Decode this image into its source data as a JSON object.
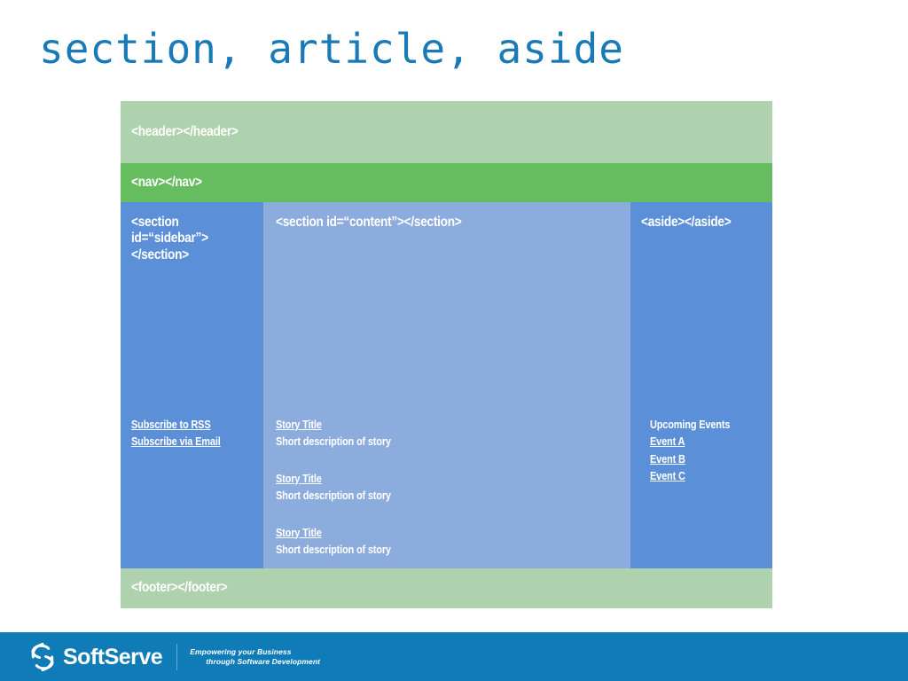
{
  "slide": {
    "title": "section, article, aside",
    "title_color": "#1a7ab8"
  },
  "diagram": {
    "header": {
      "label": "<header></header>",
      "color": "#aed2ad"
    },
    "nav": {
      "label": "<nav></nav>",
      "color": "#65bd60"
    },
    "sidebar": {
      "label": "<section id=“sidebar”></section>",
      "color": "#5b8fd8",
      "links": [
        "Subscribe to RSS",
        "Subscribe via Email"
      ]
    },
    "content": {
      "label": "<section id=“content”></section>",
      "color": "#8dacde",
      "stories": [
        {
          "title": "Story Title",
          "description": "Short description of story"
        },
        {
          "title": "Story Title",
          "description": "Short description of story"
        },
        {
          "title": "Story Title",
          "description": "Short description of story"
        }
      ]
    },
    "aside": {
      "label": "<aside></aside>",
      "color": "#5b8fd8",
      "heading": "Upcoming Events",
      "events": [
        "Event A",
        "Event B",
        "Event C"
      ]
    },
    "footer": {
      "label": "<footer></footer>",
      "color": "#aed2ad"
    }
  },
  "brand": {
    "bar_color": "#0f7cb8",
    "logo_icon": "softserve-s-mark",
    "name": "SoftServe",
    "tagline_line1": "Empowering your Business",
    "tagline_line2": "through Software Development"
  }
}
